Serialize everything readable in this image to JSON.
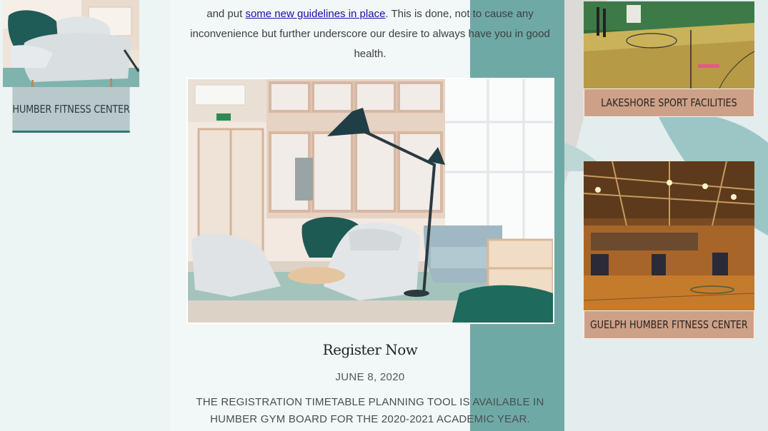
{
  "left_card": {
    "caption": "HUMBER FITNESS CENTER",
    "image_icon": "lounge-chairs-image"
  },
  "intro": {
    "prefix": "and put ",
    "link_text": "some new guidelines in place",
    "suffix": ". This is done, not to cause any inconvenience but further underscore our desire to always have you in good health."
  },
  "post": {
    "image_icon": "lounge-room-image",
    "title": "Register Now",
    "date": "JUNE 8, 2020",
    "excerpt": "THE REGISTRATION TIMETABLE PLANNING TOOL IS AVAILABLE IN HUMBER GYM BOARD FOR THE 2020-2021 ACADEMIC YEAR."
  },
  "right_cards": [
    {
      "caption": "LAKESHORE SPORT FACILITIES",
      "image_icon": "basketball-court-image"
    },
    {
      "caption": "GUELPH HUMBER FITNESS CENTER",
      "image_icon": "gymnasium-image"
    }
  ],
  "colors": {
    "accent_teal": "#2a7a73",
    "backdrop_teal": "#6fa9a6",
    "caption_tan": "#cda188",
    "caption_grey": "#b9c9cb",
    "link": "#1a0dab"
  }
}
